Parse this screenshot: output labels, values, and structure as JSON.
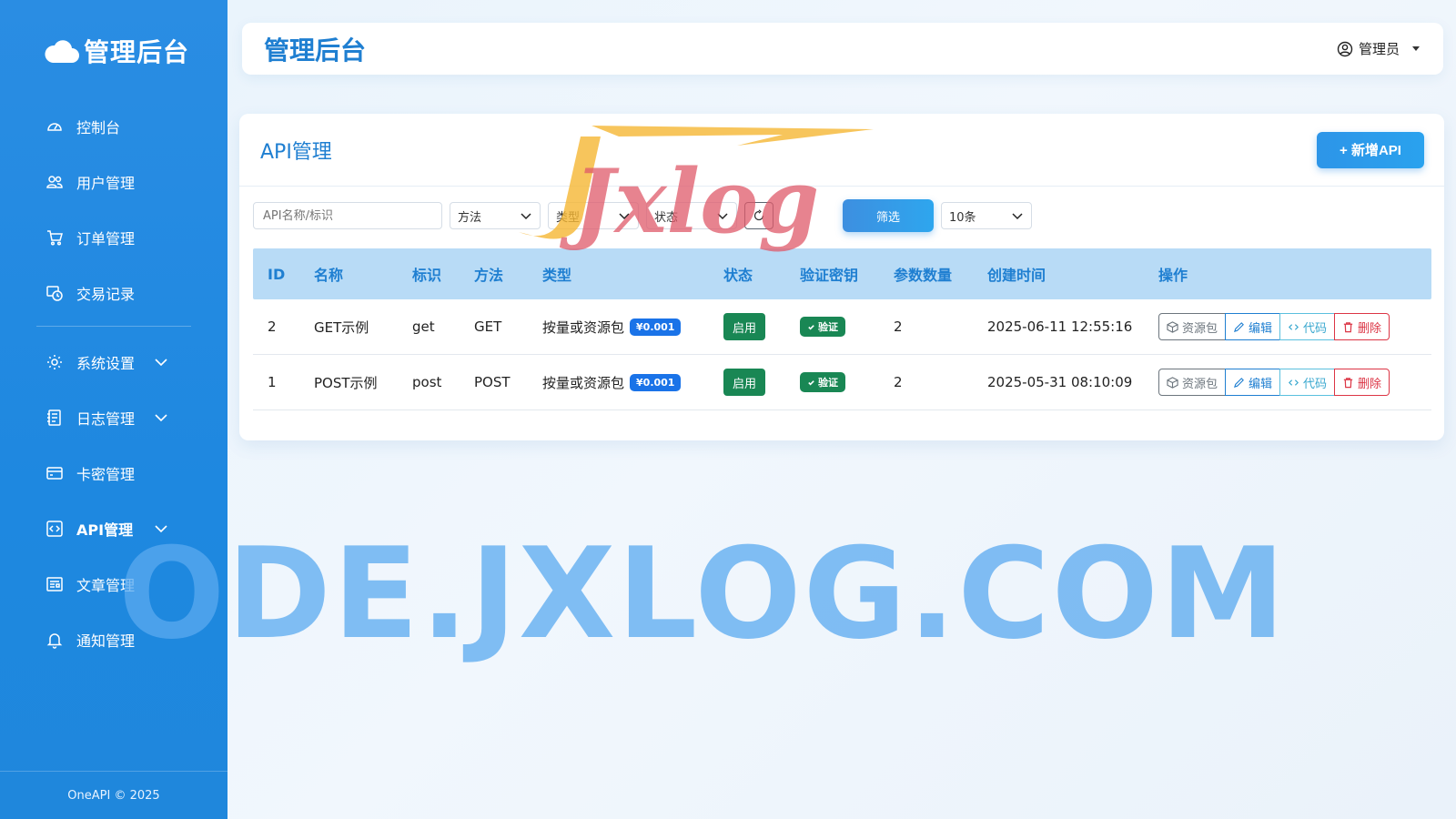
{
  "sidebar": {
    "brand": "管理后台",
    "items": [
      {
        "label": "控制台"
      },
      {
        "label": "用户管理"
      },
      {
        "label": "订单管理"
      },
      {
        "label": "交易记录"
      },
      {
        "label": "系统设置"
      },
      {
        "label": "日志管理"
      },
      {
        "label": "卡密管理"
      },
      {
        "label": "API管理"
      },
      {
        "label": "文章管理"
      },
      {
        "label": "通知管理"
      }
    ],
    "footer": "OneAPI © 2025"
  },
  "header": {
    "title": "管理后台",
    "user": "管理员"
  },
  "card": {
    "title": "API管理",
    "add_button": "+ 新增API"
  },
  "filters": {
    "search_placeholder": "API名称/标识",
    "method": "方法",
    "type": "类型",
    "status": "状态",
    "filter_button": "筛选",
    "page_size": "10条"
  },
  "table": {
    "headers": [
      "ID",
      "名称",
      "标识",
      "方法",
      "类型",
      "状态",
      "验证密钥",
      "参数数量",
      "创建时间",
      "操作"
    ],
    "rows": [
      {
        "id": "2",
        "name": "GET示例",
        "ident": "get",
        "method": "GET",
        "type": "按量或资源包",
        "price": "¥0.001",
        "status": "启用",
        "verify": "验证",
        "params": "2",
        "created": "2025-06-11 12:55:16"
      },
      {
        "id": "1",
        "name": "POST示例",
        "ident": "post",
        "method": "POST",
        "type": "按量或资源包",
        "price": "¥0.001",
        "status": "启用",
        "verify": "验证",
        "params": "2",
        "created": "2025-05-31 08:10:09"
      }
    ],
    "ops": {
      "pack": "资源包",
      "edit": "编辑",
      "code": "代码",
      "delete": "删除"
    }
  },
  "watermark": {
    "logo": "Jxlog",
    "domain": "ODE.JXLOG.COM"
  },
  "colors": {
    "primary": "#1f7fd1",
    "sidebar": "#2a8de3",
    "success": "#198754",
    "danger": "#dc3545"
  }
}
